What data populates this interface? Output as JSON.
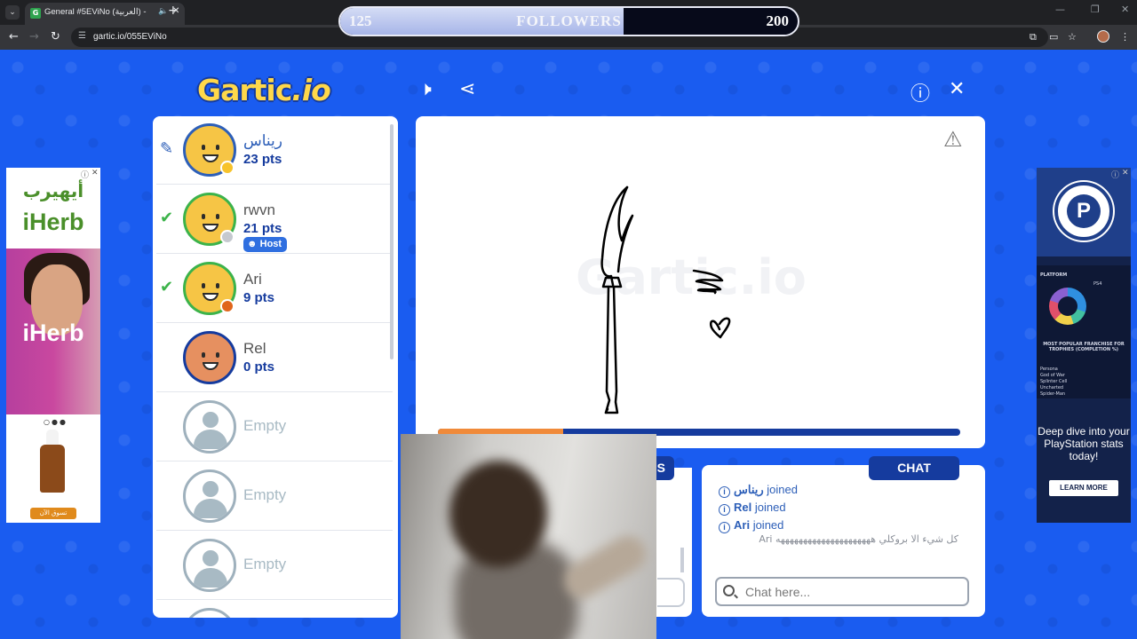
{
  "browser": {
    "tab_title": "General #5EViNo (العربية) -",
    "url": "gartic.io/055EViNo",
    "menu_icon": "chevron-down",
    "close_glyph": "✕",
    "new_tab_glyph": "+"
  },
  "followers": {
    "current": "125",
    "label": "FOLLOWERS",
    "goal": "200",
    "progress": 0.62
  },
  "game": {
    "logo_main": "Gartic",
    "logo_suffix": ".io",
    "watermark": "Gartic.io",
    "timer_progress": 0.24
  },
  "players": [
    {
      "name": "ريناس",
      "pts": "23 pts",
      "status": "drawing",
      "badge_color": "#f7c32b"
    },
    {
      "name": "rwvn",
      "pts": "21 pts",
      "status": "guessed",
      "badge_color": "#c5c9cf",
      "host_label": "Host"
    },
    {
      "name": "Ari",
      "pts": "9 pts",
      "status": "guessed",
      "badge_color": "#e0661c"
    },
    {
      "name": "Rel",
      "pts": "0 pts",
      "status": "none"
    },
    {
      "name": "Empty"
    },
    {
      "name": "Empty"
    },
    {
      "name": "Empty"
    }
  ],
  "panels": {
    "answers_tab_label": "S",
    "chat_tab_label": "CHAT"
  },
  "chat": {
    "joins": [
      {
        "user": "ريناس",
        "text": "joined"
      },
      {
        "user": "Rel",
        "text": "joined"
      },
      {
        "user": "Ari",
        "text": "joined"
      }
    ],
    "message": "كل شيء الا بروكلي هههههههههههههههههههههه Ari",
    "placeholder": "Chat here..."
  },
  "ads": {
    "left": {
      "arabic": "أيهيرب",
      "brand": "iHerb",
      "cta": "تسوق الآن"
    },
    "right": {
      "platform": "PLATFORM",
      "ps4": "PS4",
      "heading": "MOST POPULAR FRANCHISE FOR TROPHIES (COMPLETION %)",
      "games": [
        "Persona",
        "God of War",
        "Splinter Cell",
        "Uncharted",
        "Spider-Man"
      ],
      "body": "Deep dive into your PlayStation stats today!",
      "cta": "LEARN MORE"
    }
  },
  "colors": {
    "page_bg": "#1a5cf0",
    "panel_accent": "#153b9e",
    "timer_fill": "#f08a3a"
  }
}
